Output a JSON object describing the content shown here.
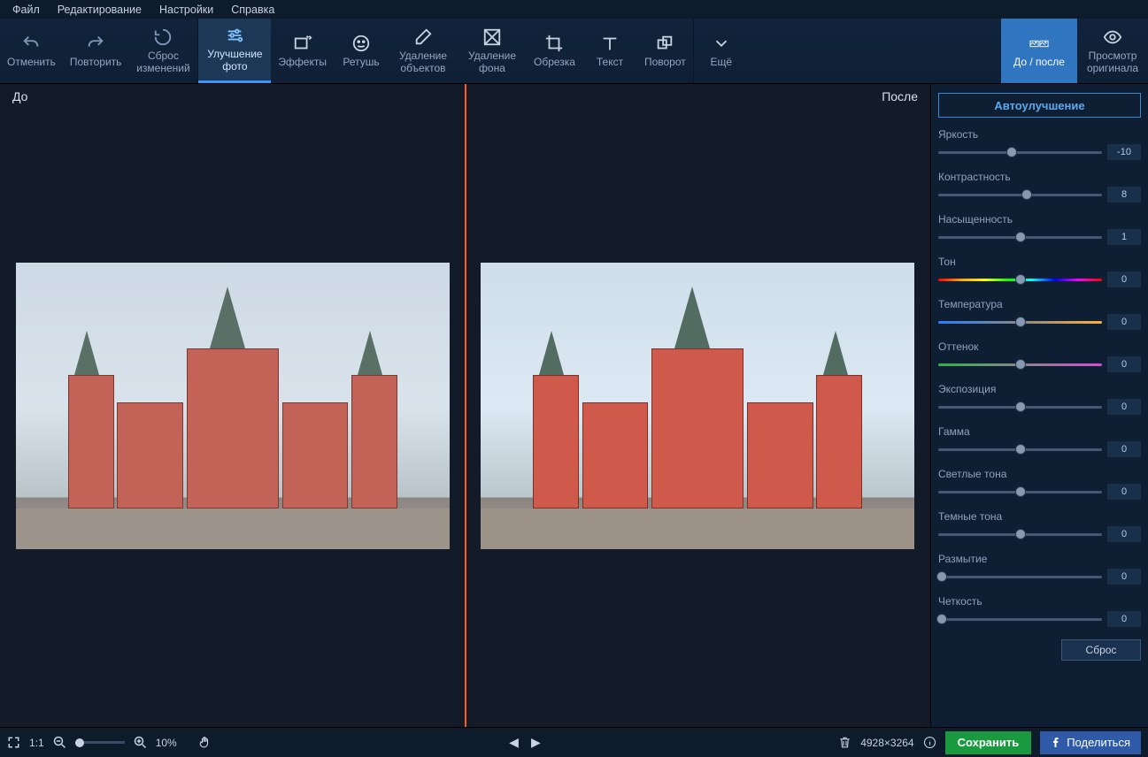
{
  "menu": {
    "file": "Файл",
    "edit": "Редактирование",
    "settings": "Настройки",
    "help": "Справка"
  },
  "toolbar": {
    "undo": "Отменить",
    "redo": "Повторить",
    "reset": "Сброс\nизменений",
    "enhance": "Улучшение\nфото",
    "effects": "Эффекты",
    "retouch": "Ретушь",
    "removeObj": "Удаление\nобъектов",
    "removeBg": "Удаление\nфона",
    "crop": "Обрезка",
    "text": "Текст",
    "rotate": "Поворот",
    "more": "Ещё",
    "beforeAfter": "До / после",
    "viewOriginal": "Просмотр\nоригинала"
  },
  "canvas": {
    "before": "До",
    "after": "После"
  },
  "panel": {
    "auto": "Автоулучшение",
    "reset": "Сброс",
    "sliders": [
      {
        "label": "Яркость",
        "value": -10,
        "pos": 45,
        "track": ""
      },
      {
        "label": "Контрастность",
        "value": 8,
        "pos": 54,
        "track": ""
      },
      {
        "label": "Насыщенность",
        "value": 1,
        "pos": 50,
        "track": ""
      },
      {
        "label": "Тон",
        "value": 0,
        "pos": 50,
        "track": "hue"
      },
      {
        "label": "Температура",
        "value": 0,
        "pos": 50,
        "track": "temp"
      },
      {
        "label": "Оттенок",
        "value": 0,
        "pos": 50,
        "track": "tint"
      },
      {
        "label": "Экспозиция",
        "value": 0,
        "pos": 50,
        "track": ""
      },
      {
        "label": "Гамма",
        "value": 0,
        "pos": 50,
        "track": ""
      },
      {
        "label": "Светлые тона",
        "value": 0,
        "pos": 50,
        "track": ""
      },
      {
        "label": "Темные тона",
        "value": 0,
        "pos": 50,
        "track": ""
      },
      {
        "label": "Размытие",
        "value": 0,
        "pos": 2,
        "track": ""
      },
      {
        "label": "Четкость",
        "value": 0,
        "pos": 2,
        "track": ""
      }
    ]
  },
  "bottom": {
    "zoom": "10%",
    "fit": "1:1",
    "dims": "4928×3264",
    "save": "Сохранить",
    "share": "Поделиться"
  }
}
